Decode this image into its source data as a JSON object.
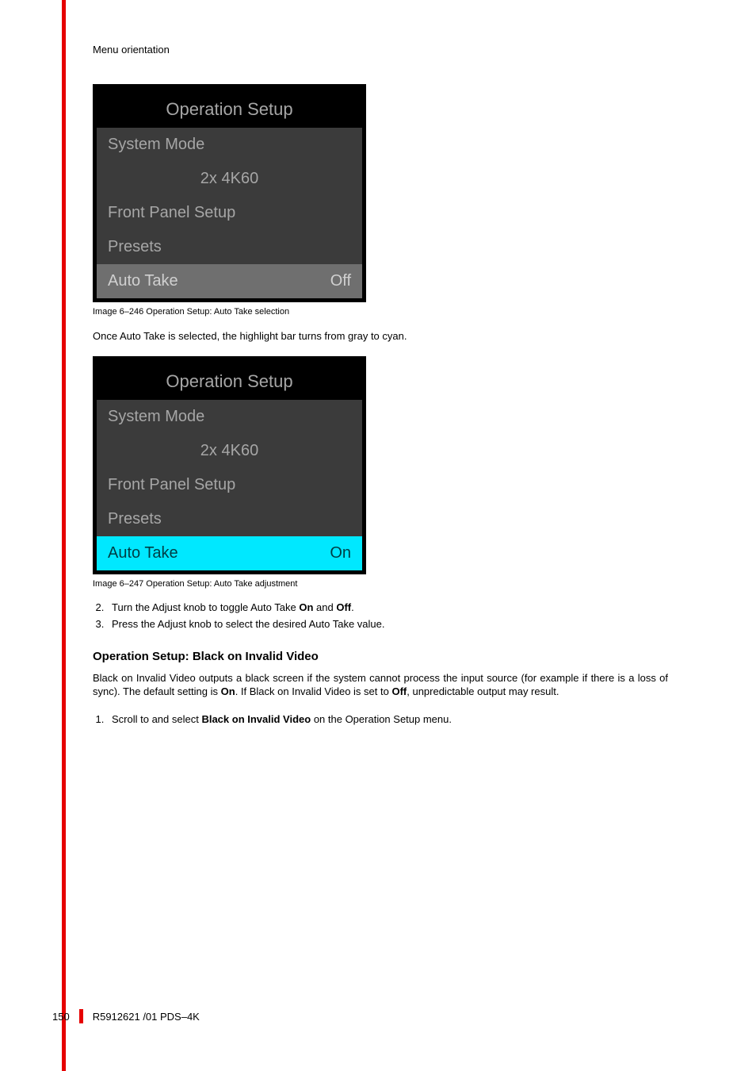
{
  "header": "Menu orientation",
  "fig1": {
    "title": "Operation Setup",
    "rows": {
      "system_mode": "System Mode",
      "mode_val": "2x 4K60",
      "front_panel": "Front Panel Setup",
      "presets": "Presets",
      "auto_take_label": "Auto Take",
      "auto_take_val": "Off"
    },
    "caption": "Image 6–246  Operation Setup: Auto Take selection"
  },
  "para1": "Once Auto Take is selected, the highlight bar turns from gray to cyan.",
  "fig2": {
    "title": "Operation Setup",
    "rows": {
      "system_mode": "System Mode",
      "mode_val": "2x 4K60",
      "front_panel": "Front Panel Setup",
      "presets": "Presets",
      "auto_take_label": "Auto Take",
      "auto_take_val": "On"
    },
    "caption": "Image 6–247  Operation Setup: Auto Take adjustment"
  },
  "steps_a": {
    "s2_pre": "Turn the Adjust knob to toggle Auto Take ",
    "s2_b1": "On",
    "s2_mid": " and ",
    "s2_b2": "Off",
    "s2_post": ".",
    "s3": "Press the Adjust knob to select the desired Auto Take value."
  },
  "section_heading": "Operation Setup: Black on Invalid Video",
  "para2": {
    "t1": "Black on Invalid Video outputs a black screen if the system cannot process the input source (for example if there is a loss of sync). The default setting is ",
    "b1": "On",
    "t2": ". If Black on Invalid Video is set to ",
    "b2": "Off",
    "t3": ", unpredictable output may result."
  },
  "steps_b": {
    "s1_pre": "Scroll to and select ",
    "s1_b": "Black on Invalid Video",
    "s1_post": " on the Operation Setup menu."
  },
  "footer": {
    "page": "150",
    "doc": "R5912621 /01 PDS–4K"
  }
}
